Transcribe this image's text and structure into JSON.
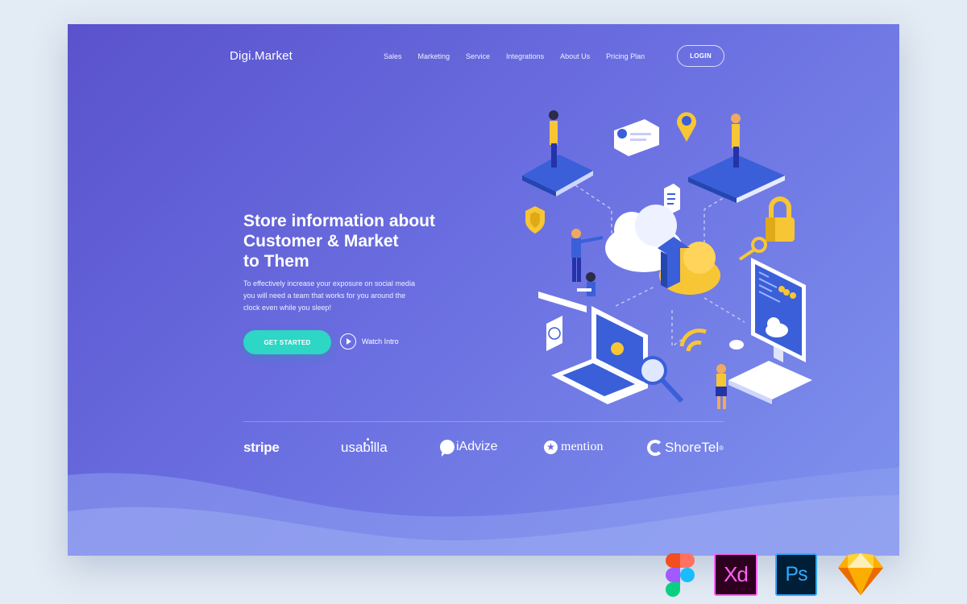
{
  "brand": {
    "logo": "Digi.Market"
  },
  "nav": {
    "items": [
      "Sales",
      "Marketing",
      "Service",
      "Integrations",
      "About Us",
      "Pricing Plan"
    ],
    "login_label": "LOGIN"
  },
  "hero": {
    "title_lines": [
      "Store information about",
      "Customer & Market",
      "to Them"
    ],
    "description_lines": [
      "To effectively increase your exposure on social media",
      "you will need a team that works for you around the",
      "clock even while you sleep!"
    ],
    "cta_label": "GET STARTED",
    "watch_label": "Watch Intro"
  },
  "partners": {
    "stripe": "stripe",
    "usabilla": "usabilla",
    "iadvize": "iAdvize",
    "mention": "mention",
    "shoretel": "ShoreTel",
    "shoretel_mark": "®"
  },
  "tools": {
    "xd": "Xd",
    "ps": "Ps",
    "icons": [
      "figma-icon",
      "adobe-xd-icon",
      "photoshop-icon",
      "sketch-icon"
    ]
  },
  "colors": {
    "page_bg": "#e3ebf4",
    "card_gradient_start": "#5a52cc",
    "card_gradient_end": "#7f93ee",
    "cta": "#2dd6c5",
    "illustration_yellow": "#f7c634",
    "illustration_blue": "#3a5fd9"
  }
}
